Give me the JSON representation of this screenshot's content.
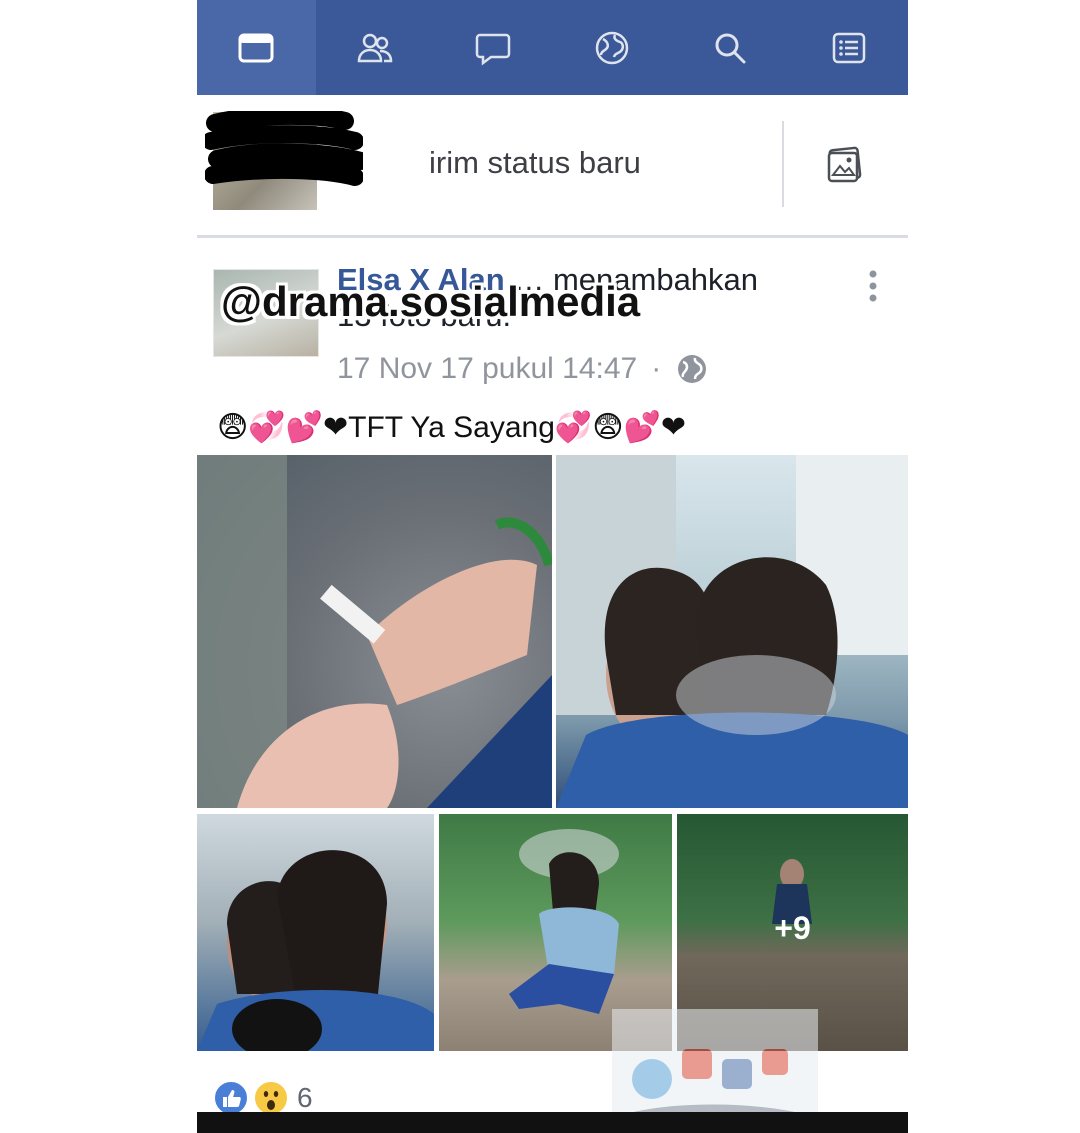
{
  "nav": {
    "tabs": [
      {
        "icon": "news-feed-icon",
        "active": true
      },
      {
        "icon": "friends-icon",
        "active": false
      },
      {
        "icon": "messages-icon",
        "active": false
      },
      {
        "icon": "globe-notifications-icon",
        "active": false
      },
      {
        "icon": "search-icon",
        "active": false
      },
      {
        "icon": "menu-list-icon",
        "active": false
      }
    ],
    "bar_color": "#3b5998"
  },
  "composer": {
    "placeholder_visible": "irim status baru",
    "photo_icon": "photo-icon"
  },
  "post": {
    "author_partial": "Elsa X Alan",
    "action_partial": "menambahkan",
    "action_line2": "13 foto baru.",
    "timestamp": "17 Nov 17 pukul 14:47",
    "separator": "·",
    "privacy_icon": "globe-icon",
    "caption": "😨💞💕❤TFT Ya Sayang💞😨💕❤",
    "photos_more": "+9",
    "reaction_count": "6"
  },
  "overlay": {
    "watermark": "@drama.sosialmedia"
  }
}
